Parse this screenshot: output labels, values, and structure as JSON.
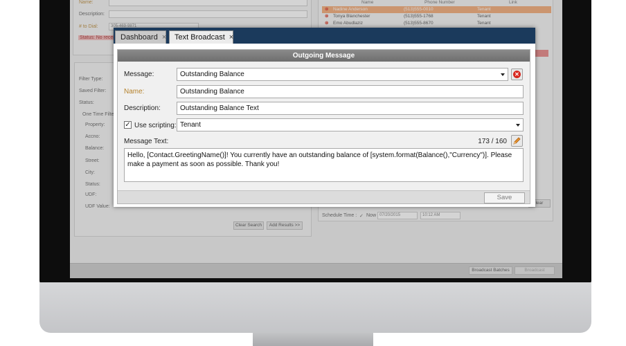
{
  "background_app": {
    "left_panel": {
      "name_label": "Name:",
      "description_label": "Description:",
      "number_to_dial_label": "# to Dial:",
      "number_to_dial_value": "305-469-9871",
      "status_text": "Status: No recei",
      "filter_type_label": "Filter Type:",
      "saved_filter_label": "Saved Filter:",
      "status_label": "Status:",
      "one_time_filter_label": "One Time Filte",
      "property_label": "Property:",
      "accno_label": "Accno:",
      "balance_label": "Balance:",
      "street_label": "Street:",
      "city_label": "City:",
      "status2_label": "Status:",
      "udf_label": "UDF:",
      "udf_value_label": "UDF Value:",
      "clear_search": "Clear Search",
      "add_results": "Add Results >>"
    },
    "right_panel": {
      "headers": {
        "name": "Name",
        "phone": "Phone Number",
        "link": "Link"
      },
      "rows": [
        {
          "name": "Nadine Anderson",
          "phone": "(513)555-0010",
          "link": "Tenant"
        },
        {
          "name": "Tonya Blanchester",
          "phone": "(513)555-1768",
          "link": "Tenant"
        },
        {
          "name": "Emo Abudlaziz",
          "phone": "(513)555-8670",
          "link": "Tenant"
        }
      ],
      "schedule_time_label": "Schedule Time :",
      "now_label": "Now",
      "date_value": "07/20/2015",
      "time_value": "10:12 AM",
      "clear_button": "lear"
    },
    "bottom_bar": {
      "broadcast_batches": "Broadcast Batches",
      "broadcast": "Broadcast"
    }
  },
  "tabs": {
    "dashboard": "Dashboard",
    "text_broadcast": "Text Broadcast",
    "close_glyph": "×"
  },
  "dialog": {
    "title": "Outgoing Message",
    "message_label": "Message:",
    "message_value": "Outstanding Balance",
    "name_label": "Name:",
    "name_value": "Outstanding Balance",
    "description_label": "Description:",
    "description_value": "Outstanding Balance Text",
    "use_scripting_label": "Use scripting:",
    "use_scripting_checked": true,
    "scripting_value": "Tenant",
    "message_text_label": "Message Text:",
    "char_count": "173 / 160",
    "message_text": "Hello, [Contact.GreetingName()]!  You currently have an outstanding balance of [system.format(Balance(),\"Currency\")].  Please make a payment as soon as possible.  Thank you!",
    "save_button": "Save"
  },
  "colors": {
    "tab_bar": "#1b3a5c",
    "dialog_title_bar": "#7a7a7a",
    "name_label_orange": "#b5822c",
    "selected_row": "#f2a36b",
    "delete_red": "#d8281f",
    "edit_orange": "#e8962e"
  },
  "icons": {
    "delete": "delete-circle-icon",
    "edit": "pencil-edit-icon",
    "dropdown": "chevron-down-icon",
    "close": "close-icon"
  }
}
